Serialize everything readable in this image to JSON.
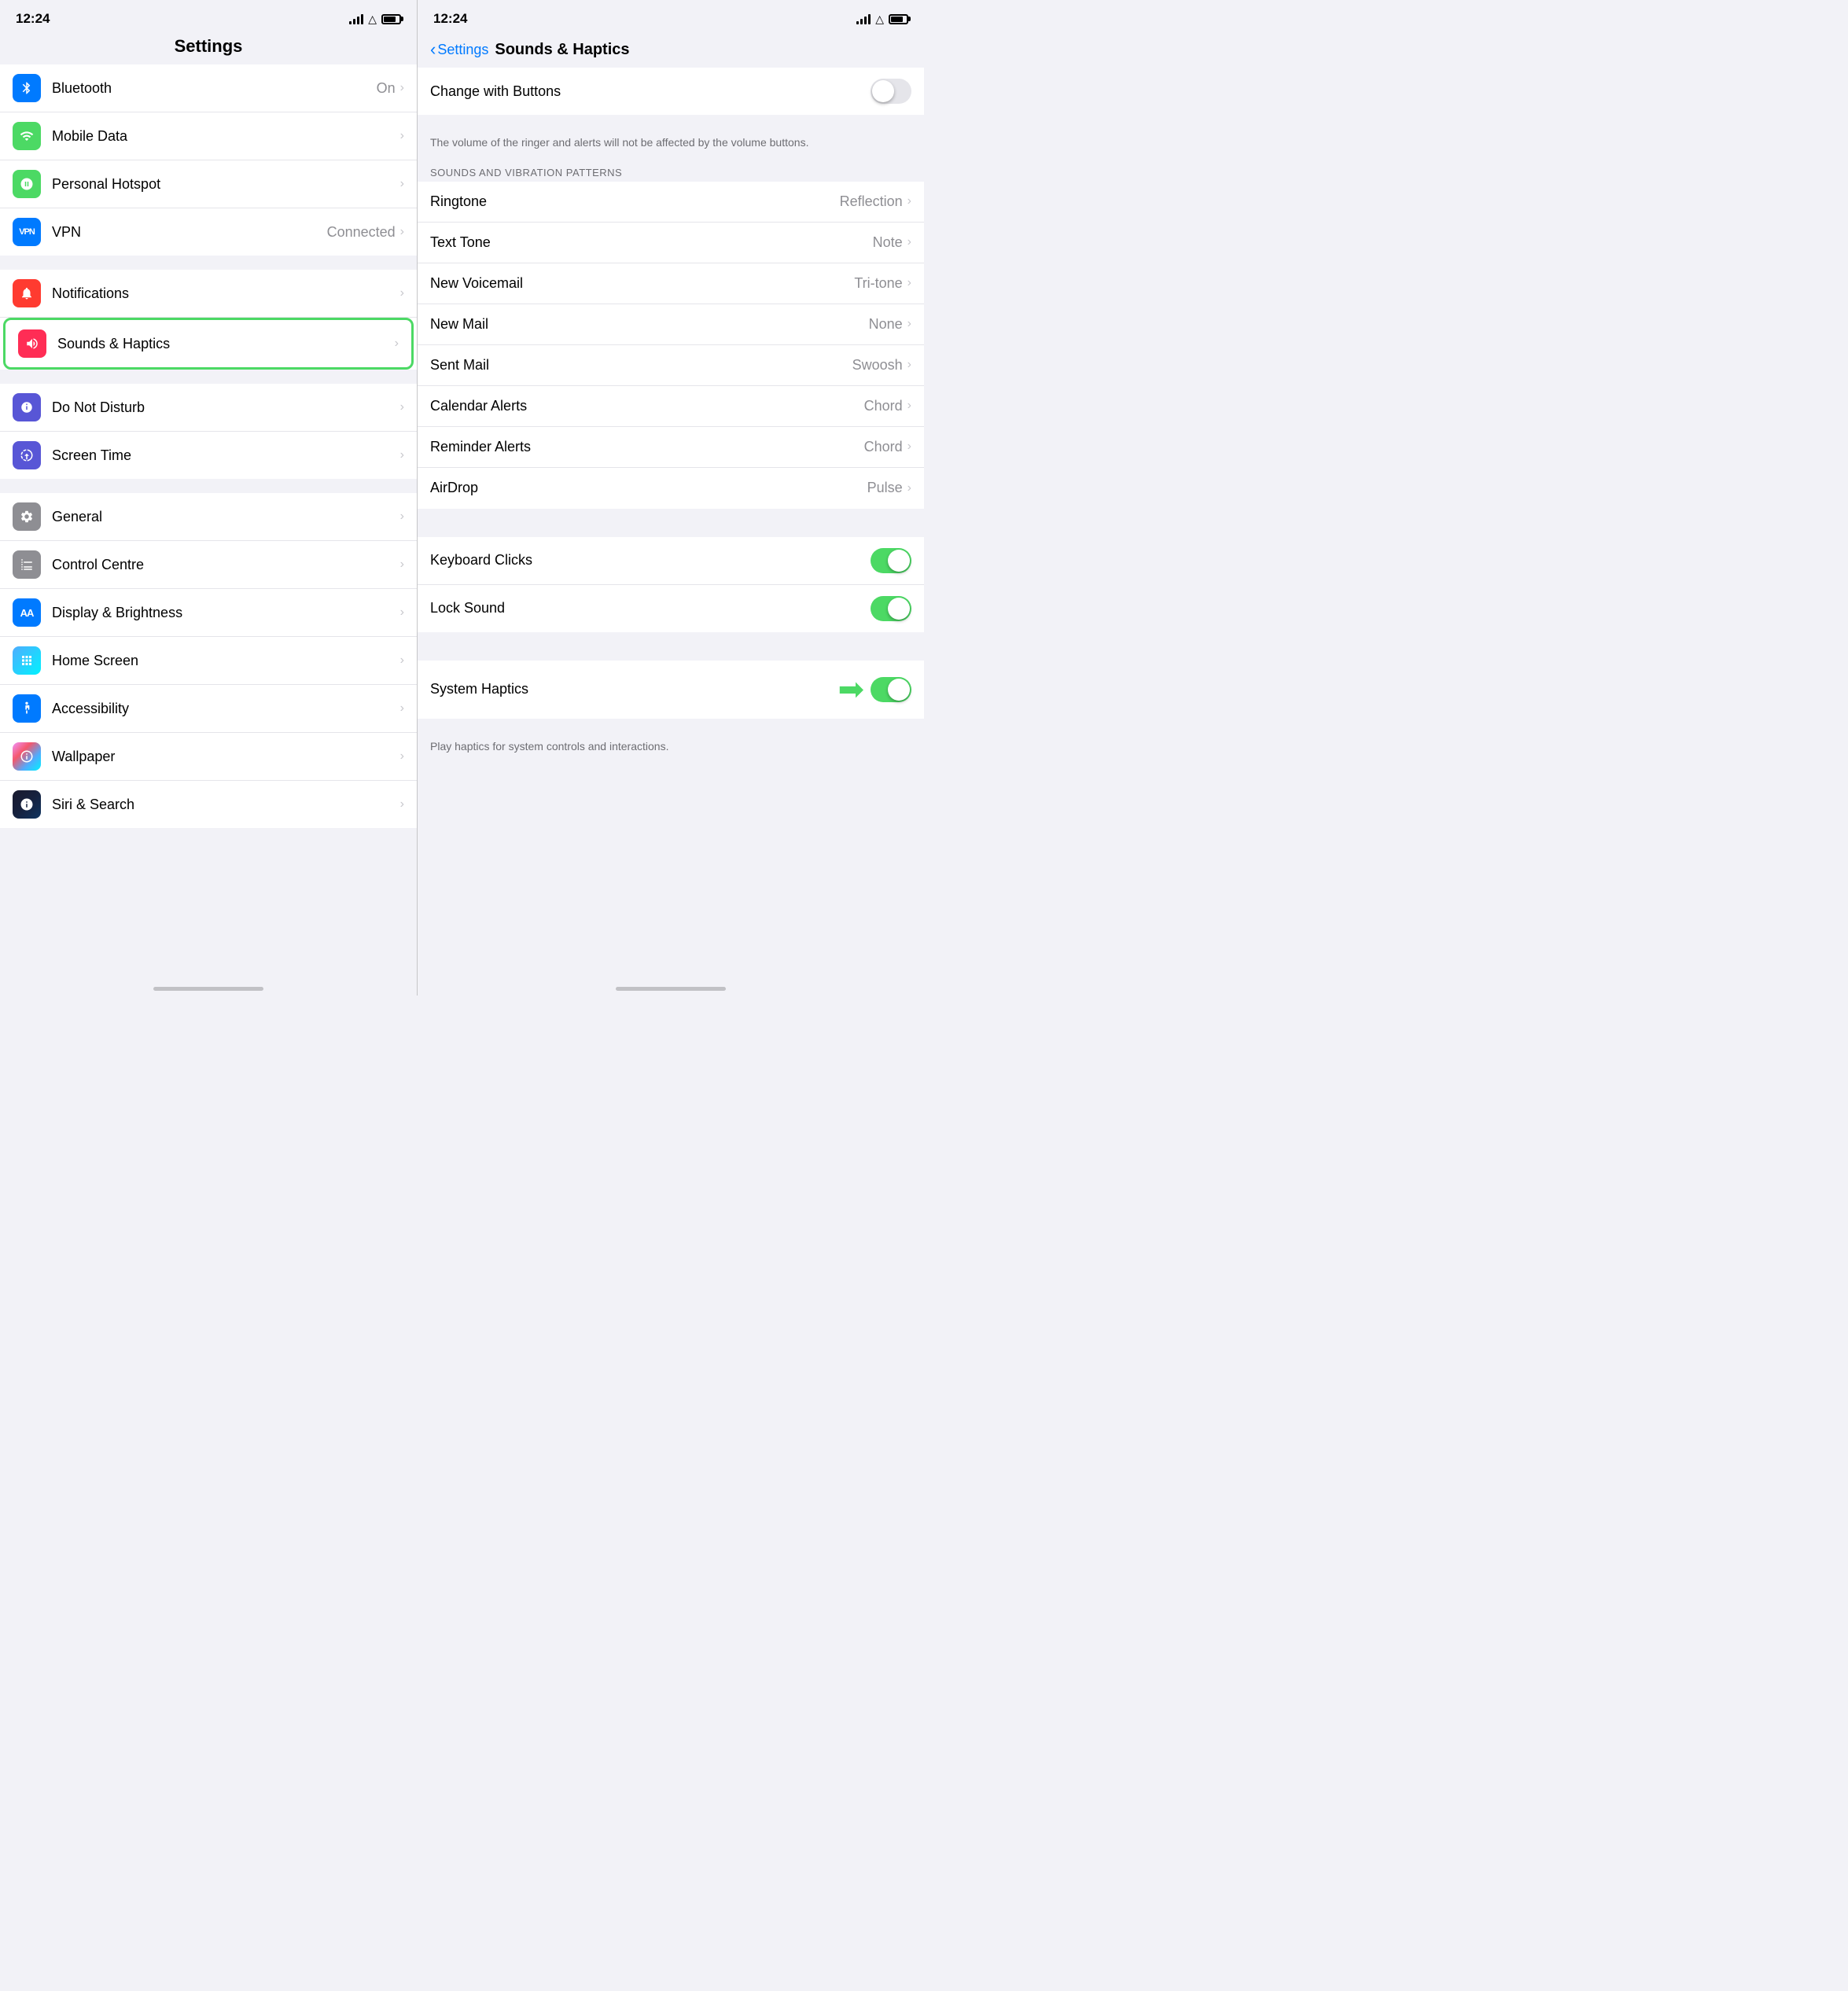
{
  "left": {
    "statusBar": {
      "time": "12:24",
      "location": "↗"
    },
    "title": "Settings",
    "groups": [
      {
        "id": "connectivity",
        "items": [
          {
            "id": "bluetooth",
            "label": "Bluetooth",
            "value": "On",
            "iconBg": "icon-blue",
            "iconSymbol": "bluetooth"
          },
          {
            "id": "mobiledata",
            "label": "Mobile Data",
            "value": "",
            "iconBg": "icon-green",
            "iconSymbol": "signal"
          },
          {
            "id": "hotspot",
            "label": "Personal Hotspot",
            "value": "",
            "iconBg": "icon-green",
            "iconSymbol": "hotspot"
          },
          {
            "id": "vpn",
            "label": "VPN",
            "value": "Connected",
            "iconBg": "icon-blue-aa",
            "iconSymbol": "vpn"
          }
        ]
      },
      {
        "id": "system1",
        "items": [
          {
            "id": "notifications",
            "label": "Notifications",
            "value": "",
            "iconBg": "icon-red",
            "iconSymbol": "bell",
            "highlighted": false
          },
          {
            "id": "sounds",
            "label": "Sounds & Haptics",
            "value": "",
            "iconBg": "icon-pink-red",
            "iconSymbol": "speaker",
            "highlighted": true
          }
        ]
      },
      {
        "id": "system2",
        "items": [
          {
            "id": "donotdisturb",
            "label": "Do Not Disturb",
            "value": "",
            "iconBg": "icon-purple",
            "iconSymbol": "moon"
          },
          {
            "id": "screentime",
            "label": "Screen Time",
            "value": "",
            "iconBg": "icon-purple",
            "iconSymbol": "hourglass"
          }
        ]
      },
      {
        "id": "system3",
        "items": [
          {
            "id": "general",
            "label": "General",
            "value": "",
            "iconBg": "icon-gray",
            "iconSymbol": "gear"
          },
          {
            "id": "controlcentre",
            "label": "Control Centre",
            "value": "",
            "iconBg": "icon-gray",
            "iconSymbol": "sliders"
          },
          {
            "id": "displaybrightness",
            "label": "Display & Brightness",
            "value": "",
            "iconBg": "icon-blue-aa",
            "iconSymbol": "AA"
          },
          {
            "id": "homescreen",
            "label": "Home Screen",
            "value": "",
            "iconBg": "icon-blue-aa",
            "iconSymbol": "grid"
          },
          {
            "id": "accessibility",
            "label": "Accessibility",
            "value": "",
            "iconBg": "icon-blue-aa",
            "iconSymbol": "accessibility"
          },
          {
            "id": "wallpaper",
            "label": "Wallpaper",
            "value": "",
            "iconBg": "icon-multicolor",
            "iconSymbol": "flower"
          },
          {
            "id": "sirisearch",
            "label": "Siri & Search",
            "value": "",
            "iconBg": "icon-siri",
            "iconSymbol": "siri"
          }
        ]
      }
    ]
  },
  "right": {
    "statusBar": {
      "time": "12:24",
      "location": "↗"
    },
    "backLabel": "Settings",
    "title": "Sounds & Haptics",
    "topSection": {
      "items": [
        {
          "id": "changewithbuttons",
          "label": "Change with Buttons",
          "toggleOn": false
        }
      ],
      "description": "The volume of the ringer and alerts will not be affected by the volume buttons."
    },
    "soundsSection": {
      "header": "SOUNDS AND VIBRATION PATTERNS",
      "items": [
        {
          "id": "ringtone",
          "label": "Ringtone",
          "value": "Reflection"
        },
        {
          "id": "texttone",
          "label": "Text Tone",
          "value": "Note"
        },
        {
          "id": "newvoicemail",
          "label": "New Voicemail",
          "value": "Tri-tone"
        },
        {
          "id": "newmail",
          "label": "New Mail",
          "value": "None"
        },
        {
          "id": "sentmail",
          "label": "Sent Mail",
          "value": "Swoosh"
        },
        {
          "id": "calendaralerts",
          "label": "Calendar Alerts",
          "value": "Chord"
        },
        {
          "id": "reminderalerts",
          "label": "Reminder Alerts",
          "value": "Chord"
        },
        {
          "id": "airdrop",
          "label": "AirDrop",
          "value": "Pulse"
        }
      ]
    },
    "soundsToggles": {
      "items": [
        {
          "id": "keyboardclicks",
          "label": "Keyboard Clicks",
          "toggleOn": true
        },
        {
          "id": "locksound",
          "label": "Lock Sound",
          "toggleOn": true
        }
      ]
    },
    "hapticsSection": {
      "items": [
        {
          "id": "systemhaptics",
          "label": "System Haptics",
          "toggleOn": true
        }
      ],
      "description": "Play haptics for system controls and interactions."
    }
  }
}
